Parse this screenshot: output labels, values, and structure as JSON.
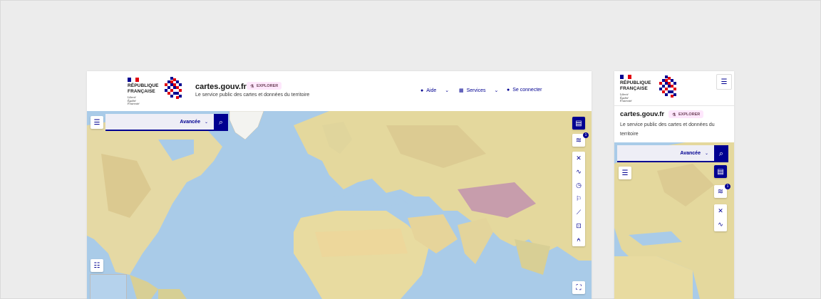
{
  "brand": {
    "republic": "République\nFrançaise",
    "motto": "Liberté\nÉgalité\nFraternité",
    "colors": {
      "blue": "#000091",
      "red": "#e1000f",
      "white": "#ffffff"
    }
  },
  "header": {
    "site_title": "cartes.gouv.fr",
    "badge": "Explorer",
    "badge_icon": "flask-icon",
    "tagline": "Le service public des cartes et données du territoire",
    "nav": [
      {
        "label": "Aide",
        "icon": "help-circle-icon"
      },
      {
        "label": "Services",
        "icon": "grid-icon"
      },
      {
        "label": "Se connecter",
        "icon": "user-icon"
      }
    ]
  },
  "search": {
    "mode_label": "Avancée",
    "icon": "search-icon"
  },
  "toolbar": {
    "basemap_icon": "map-icon",
    "layers_icon": "layers-icon",
    "layers_count": "1",
    "tools": [
      "tools-icon",
      "route-icon",
      "clock-icon",
      "signpost-icon",
      "ruler-icon",
      "crop-icon",
      "compass-icon"
    ],
    "fullscreen_icon": "fullscreen-icon",
    "legend_icon": "legend-icon",
    "catalog_icon": "catalog-icon"
  },
  "mobile": {
    "menu_icon": "hamburger-icon",
    "site_title": "cartes.gouv.fr",
    "badge": "Explorer",
    "tagline": "Le service public des cartes et données du territoire",
    "search_label": "Avancée"
  }
}
